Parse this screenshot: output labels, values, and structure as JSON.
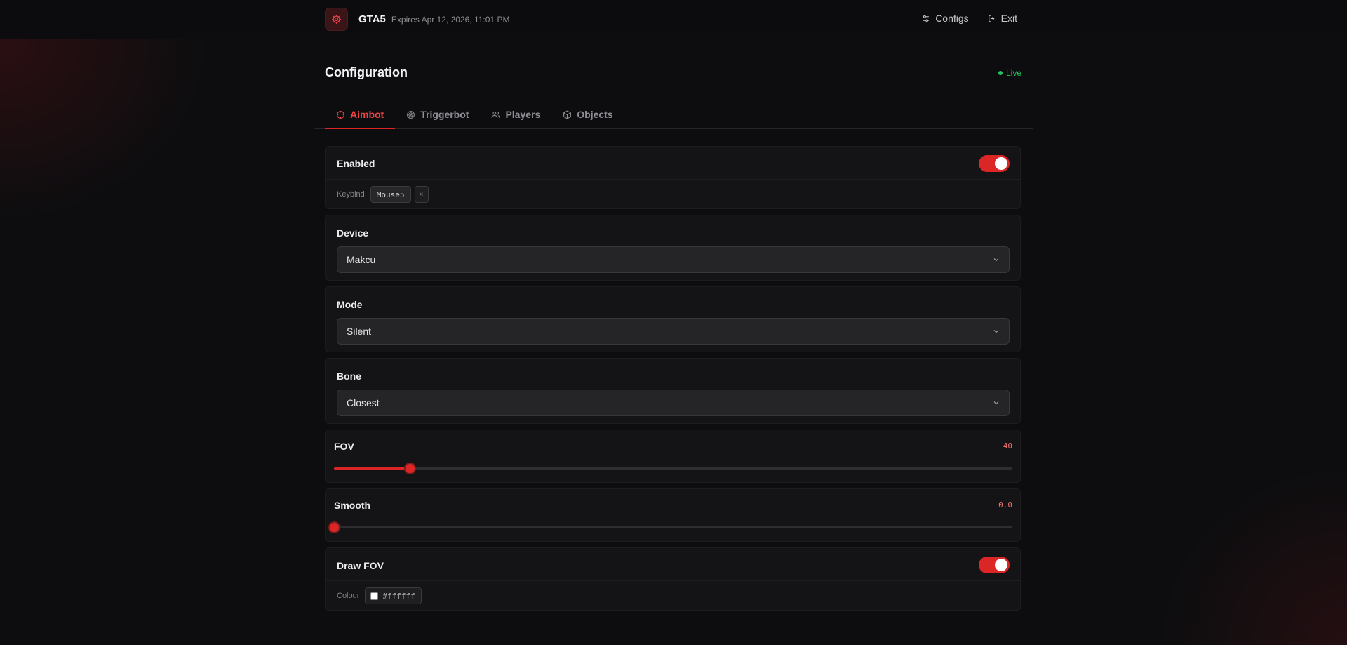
{
  "header": {
    "app_name": "GTA5",
    "expires": "Expires Apr 12, 2026, 11:01 PM",
    "icon": "gear-icon",
    "nav": [
      {
        "label": "Configs",
        "icon": "sliders-icon"
      },
      {
        "label": "Exit",
        "icon": "logout-icon"
      }
    ]
  },
  "page": {
    "title": "Configuration",
    "status": "Live",
    "status_color": "#22c55e"
  },
  "tabs": [
    {
      "label": "Aimbot",
      "icon": "crosshair-icon",
      "active": true
    },
    {
      "label": "Triggerbot",
      "icon": "target-icon",
      "active": false
    },
    {
      "label": "Players",
      "icon": "users-icon",
      "active": false
    },
    {
      "label": "Objects",
      "icon": "cube-icon",
      "active": false
    }
  ],
  "aimbot": {
    "enabled": {
      "label": "Enabled",
      "on": true,
      "keybind_label": "Keybind",
      "keybind": "Mouse5",
      "clear": "×"
    },
    "device": {
      "label": "Device",
      "value": "Makcu"
    },
    "mode": {
      "label": "Mode",
      "value": "Silent"
    },
    "bone": {
      "label": "Bone",
      "value": "Closest"
    },
    "fov": {
      "label": "FOV",
      "value": "40",
      "fraction": 0.112
    },
    "smooth": {
      "label": "Smooth",
      "value": "0.0",
      "fraction": 0
    },
    "draw_fov": {
      "label": "Draw FOV",
      "on": true,
      "colour_label": "Colour",
      "colour": "#ffffff"
    }
  },
  "colors": {
    "accent": "#dc2626",
    "background": "#0d0d0f",
    "card": "#141416"
  }
}
